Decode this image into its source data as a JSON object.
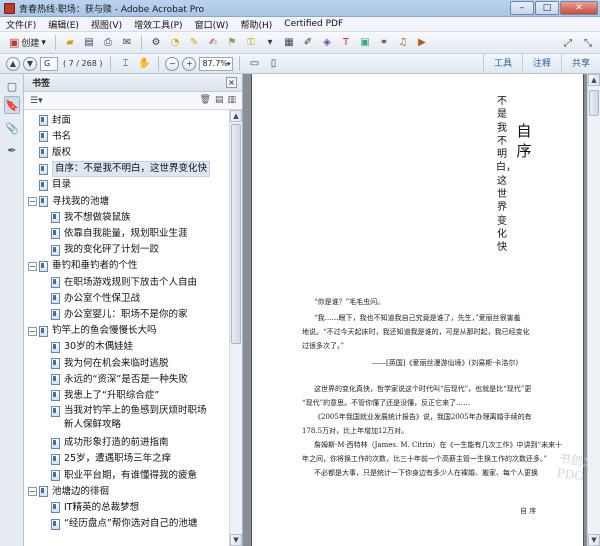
{
  "window": {
    "title": "青春热线·职场：获与赎 - Adobe Acrobat Pro",
    "minimize": "–",
    "maximize": "□",
    "close": "✕"
  },
  "menu": [
    "文件(F)",
    "编辑(E)",
    "视图(V)",
    "增效工具(P)",
    "窗口(W)",
    "帮助(H)",
    "Certified PDF"
  ],
  "toolbar": {
    "create_label": "创建",
    "create_icon": "create-pdf-icon",
    "icons": [
      "open-icon",
      "save-icon",
      "print-icon",
      "email-icon",
      "gear-icon",
      "comment-icon",
      "highlight-icon",
      "stamp-icon",
      "sign-icon",
      "secure-icon",
      "form-icon",
      "edit-icon",
      "multimedia-icon"
    ],
    "right_icons": [
      "expand-icon",
      "collapse-icon"
    ]
  },
  "nav_toolbar": {
    "page_value": "G",
    "page_count": "( 7 / 268 )",
    "zoom": "87.7%",
    "tasks": [
      "工具",
      "注释",
      "共享"
    ]
  },
  "bookmarks": {
    "header": "书签",
    "close": "×",
    "options_icon": "options-icon",
    "items": [
      {
        "label": "封面",
        "indent": 0,
        "toggle": ""
      },
      {
        "label": "书名",
        "indent": 0,
        "toggle": ""
      },
      {
        "label": "版权",
        "indent": 0,
        "toggle": ""
      },
      {
        "label": "自序：不是我不明白，这世界变化快",
        "indent": 0,
        "toggle": "",
        "selected": true
      },
      {
        "label": "目录",
        "indent": 0,
        "toggle": ""
      },
      {
        "label": "寻找我的池塘",
        "indent": 0,
        "toggle": "−"
      },
      {
        "label": "我不想做袋鼠族",
        "indent": 1,
        "toggle": ""
      },
      {
        "label": "依靠自我能量，规划职业生涯",
        "indent": 1,
        "toggle": ""
      },
      {
        "label": "我的变化砰了计划一跤",
        "indent": 1,
        "toggle": ""
      },
      {
        "label": "垂钓和垂钓者的个性",
        "indent": 0,
        "toggle": "−"
      },
      {
        "label": "在职场游戏规则下放击个人自由",
        "indent": 1,
        "toggle": ""
      },
      {
        "label": "办公室个性保卫战",
        "indent": 1,
        "toggle": ""
      },
      {
        "label": "办公室婴儿：职场不是你的家",
        "indent": 1,
        "toggle": ""
      },
      {
        "label": "钓竿上的鱼会慢慢长大吗",
        "indent": 0,
        "toggle": "−"
      },
      {
        "label": "30岁的木偶娃娃",
        "indent": 1,
        "toggle": ""
      },
      {
        "label": "我为何在机会来临时逃脱",
        "indent": 1,
        "toggle": ""
      },
      {
        "label": "永远的“资深”是否是一种失败",
        "indent": 1,
        "toggle": ""
      },
      {
        "label": "我患上了“升职综合症”",
        "indent": 1,
        "toggle": ""
      },
      {
        "label": "当我对钓竿上的鱼感到厌烦时职场新人保鲜攻略",
        "indent": 1,
        "toggle": "",
        "wrap": true
      },
      {
        "label": "成功形象打造的前进指南",
        "indent": 1,
        "toggle": ""
      },
      {
        "label": "25岁，遭遇职场三年之痒",
        "indent": 1,
        "toggle": ""
      },
      {
        "label": "职业平台期，有谁懂得我的疲惫",
        "indent": 1,
        "toggle": ""
      },
      {
        "label": "池塘边的徘徊",
        "indent": 0,
        "toggle": "−"
      },
      {
        "label": "IT精英的总裁梦想",
        "indent": 1,
        "toggle": ""
      },
      {
        "label": "“经历盘点”帮你选对自己的池塘",
        "indent": 1,
        "toggle": ""
      }
    ]
  },
  "document": {
    "vertical_title": "不是我不明白，这世界变化快",
    "big_title": "自序",
    "lines": [
      "“你是谁？”毛毛虫问。",
      "“我……眼下，我也不知道我自己究竟是谁了，先生，”爱丽丝很害羞",
      "地说。“不过今天起床时，我还知道我是谁的，可是从那时起，我已经变化",
      "过很多次了。”",
      "——[英国]《爱丽丝漫游仙境》(刘易斯·卡洛尔)",
      "这世界的变化真快，哲学家说这个时代叫“后现代”，也就是比“现代”更",
      "“现代”的意思。不管你懂了还是没懂，反正它来了……",
      "《2005年我国就业发展统计报告》说，我国2005年办理离婚手续的有",
      "178.5万对，比上年增加12万对。",
      "詹姆斯·M·西特林（James. M. Citrin）在《一生能有几次工作》中讲到“未来十",
      "年之间，你将换工作的次数，比三十年前一个高薪主管一生换工作的次数还多。”",
      "不必都是大事，只是统计一下你身边有多少人在裸婚、搬家、每个人更换"
    ],
    "footer": "自  序",
    "watermark": "书创文库 PDG"
  }
}
